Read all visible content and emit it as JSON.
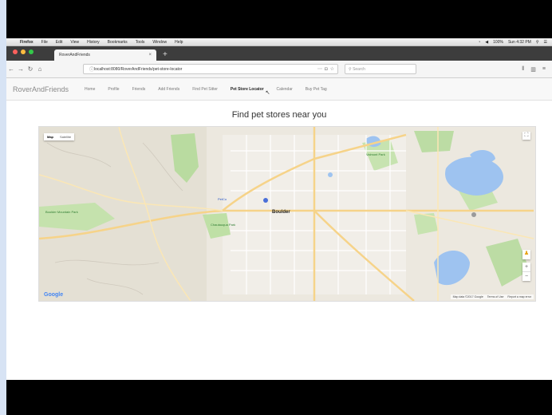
{
  "menubar": {
    "app_name": "Firefox",
    "items": [
      "File",
      "Edit",
      "View",
      "History",
      "Bookmarks",
      "Tools",
      "Window",
      "Help"
    ],
    "battery": "100%",
    "clock": "Sun 4:32 PM"
  },
  "tab": {
    "title": "RoverAndFriends",
    "close": "×"
  },
  "nav": {
    "url": "localhost:8080/RoverAndFriends/pet-store-locator",
    "search_placeholder": "Search"
  },
  "site": {
    "brand": "RoverAndFriends",
    "links": [
      "Home",
      "Profile",
      "Friends",
      "Add Friends",
      "Find Pet Sitter",
      "Pet Store Locator",
      "Calendar",
      "Buy Pet Tag"
    ]
  },
  "page": {
    "title": "Find pet stores near you"
  },
  "map": {
    "type_map": "Map",
    "type_satellite": "Satellite",
    "zoom_in": "+",
    "zoom_out": "−",
    "logo": "Google",
    "attribution": [
      "Map data ©2017 Google",
      "Terms of Use",
      "Report a map error"
    ],
    "labels": {
      "city": "Boulder",
      "store": "PetCo",
      "park_left": "Boulder Mountain Park",
      "park_right": "Valmont Park",
      "chautauqua": "Chautauqua Park"
    }
  }
}
